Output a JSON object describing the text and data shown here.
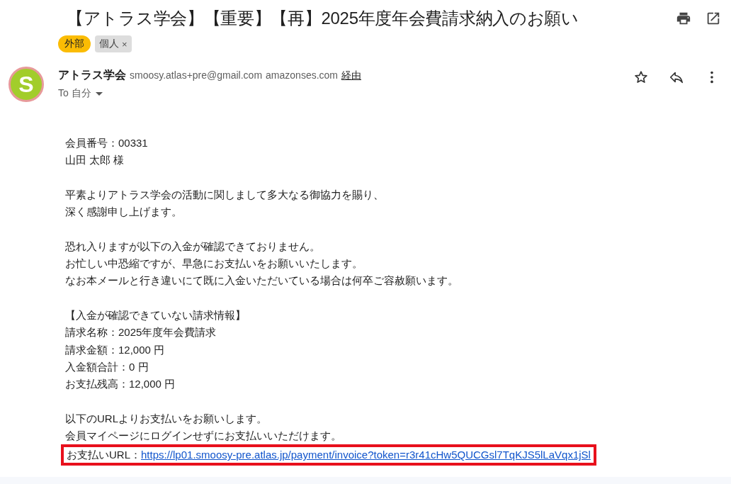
{
  "subject": "【アトラス学会】【重要】【再】2025年度年会費請求納入のお願い",
  "labels": [
    {
      "text": "外部",
      "color": "#fbbc04",
      "removable": false
    },
    {
      "text": "個人",
      "color": "#dddddd",
      "removable": true,
      "remove_glyph": "×"
    }
  ],
  "sender": {
    "avatar_letter": "S",
    "name": "アトラス学会",
    "address": "smoosy.atlas+pre@gmail.com",
    "via_domain": "amazonses.com",
    "via_link": "経由",
    "recipient": "To 自分"
  },
  "body": {
    "paragraphs": [
      [
        "会員番号：00331",
        "山田 太郎 様"
      ],
      [
        "平素よりアトラス学会の活動に関しまして多大なる御協力を賜り、",
        "深く感謝申し上げます。"
      ],
      [
        "恐れ入りますが以下の入金が確認できておりません。",
        "お忙しい中恐縮ですが、早急にお支払いをお願いいたします。",
        "なお本メールと行き違いにて既に入金いただいている場合は何卒ご容赦願います。"
      ],
      [
        "【入金が確認できていない請求情報】",
        "請求名称：2025年度年会費請求",
        "請求金額：12,000 円",
        "入金額合計：0 円",
        "お支払残高：12,000 円"
      ],
      [
        "以下のURLよりお支払いをお願いします。",
        "会員マイページにログインせずにお支払いいただけます。"
      ]
    ],
    "payment": {
      "label": "お支払いURL：",
      "url": "https://lp01.smoosy-pre.atlas.jp/payment/invoice?token=r3r41cHw5QUCGsl7TqKJS5lLaVqx1jSl",
      "highlighted": true
    }
  }
}
